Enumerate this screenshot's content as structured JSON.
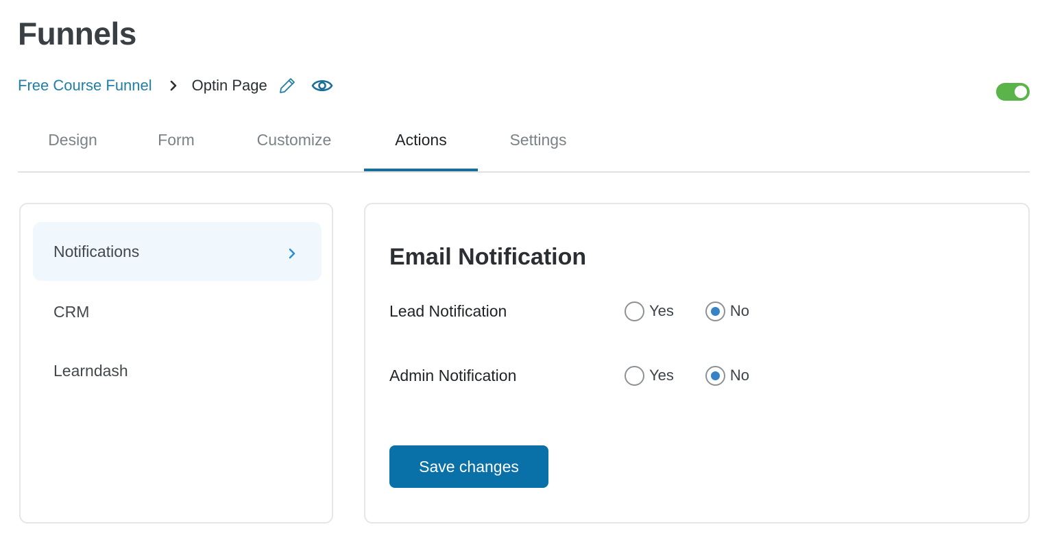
{
  "page": {
    "title": "Funnels"
  },
  "breadcrumb": {
    "parent": "Free Course Funnel",
    "separator_icon": "chevron-right-icon",
    "current": "Optin Page",
    "edit_icon": "pencil-icon",
    "preview_icon": "eye-icon"
  },
  "status_toggle": {
    "on": true,
    "color": "#5ab44a"
  },
  "tabs": [
    {
      "label": "Design",
      "active": false
    },
    {
      "label": "Form",
      "active": false
    },
    {
      "label": "Customize",
      "active": false
    },
    {
      "label": "Actions",
      "active": true
    },
    {
      "label": "Settings",
      "active": false
    }
  ],
  "sidebar": {
    "items": [
      {
        "label": "Notifications",
        "active": true
      },
      {
        "label": "CRM",
        "active": false
      },
      {
        "label": "Learndash",
        "active": false
      }
    ]
  },
  "main": {
    "section_title": "Email Notification",
    "fields": [
      {
        "label": "Lead Notification",
        "options": [
          "Yes",
          "No"
        ],
        "selected": "No"
      },
      {
        "label": "Admin Notification",
        "options": [
          "Yes",
          "No"
        ],
        "selected": "No"
      }
    ],
    "save_label": "Save changes"
  },
  "colors": {
    "accent": "#0a70a8",
    "link": "#1f7fa7",
    "radio_checked": "#3582c4",
    "sidebar_active_bg": "#f0f7fd"
  }
}
